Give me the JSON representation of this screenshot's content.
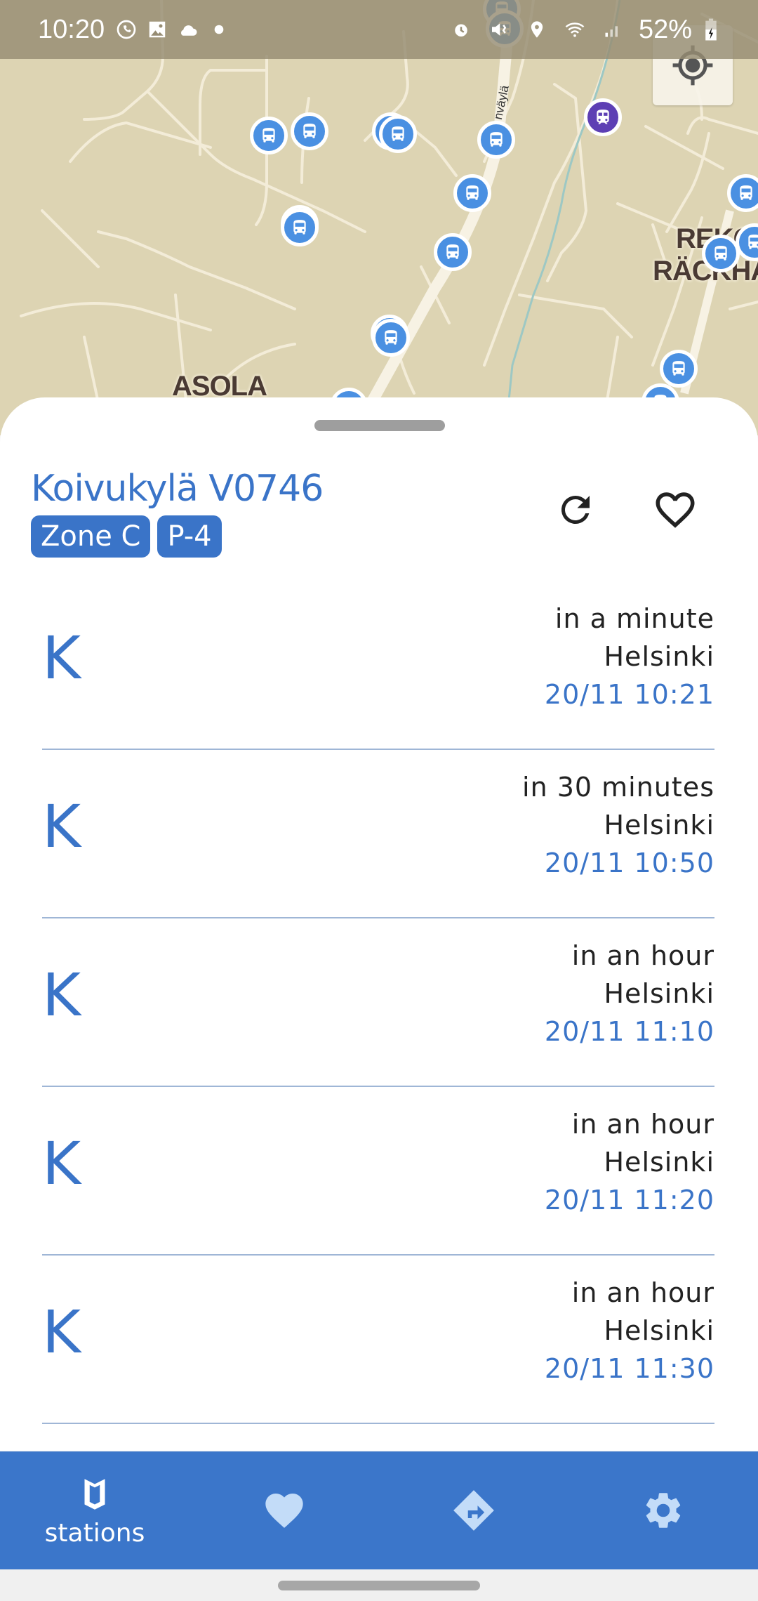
{
  "status_bar": {
    "time": "10:20",
    "left_icons": [
      "whatsapp-icon",
      "image-icon",
      "cloud-icon",
      "dot-icon"
    ],
    "right_icons": [
      "alarm-icon",
      "vibrate-mute-icon",
      "location-icon",
      "wifi-icon",
      "signal-icon"
    ],
    "battery_percent": "52%",
    "battery_charging": true
  },
  "map": {
    "place_labels": [
      "ASOLA",
      "REKO",
      "RÄCKHA"
    ],
    "street_label": "nväylä",
    "locate_button_icon": "my-location-icon",
    "stop_markers": {
      "bus_icon": "bus-icon",
      "train_icon": "train-icon"
    },
    "colors": {
      "land": "#ddd4b3",
      "road": "#f5efdc",
      "bus_stop": "#4a90e2",
      "train_stop": "#5d3fb4",
      "water": "#9dc8c4"
    }
  },
  "stop": {
    "title": "Koivukylä V0746",
    "badges": [
      "Zone C",
      "P-4"
    ],
    "refresh_icon": "refresh-icon",
    "favorite_icon": "heart-outline-icon"
  },
  "departures": [
    {
      "line": "K",
      "when": "in a minute",
      "destination": "Helsinki",
      "time": "20/11 10:21"
    },
    {
      "line": "K",
      "when": "in 30 minutes",
      "destination": "Helsinki",
      "time": "20/11 10:50"
    },
    {
      "line": "K",
      "when": "in an hour",
      "destination": "Helsinki",
      "time": "20/11 11:10"
    },
    {
      "line": "K",
      "when": "in an hour",
      "destination": "Helsinki",
      "time": "20/11 11:20"
    },
    {
      "line": "K",
      "when": "in an hour",
      "destination": "Helsinki",
      "time": "20/11 11:30"
    }
  ],
  "bottom_nav": {
    "items": [
      {
        "label": "stations",
        "icon": "map-icon",
        "active": true
      },
      {
        "label": "",
        "icon": "heart-icon",
        "active": false
      },
      {
        "label": "",
        "icon": "directions-icon",
        "active": false
      },
      {
        "label": "",
        "icon": "settings-icon",
        "active": false
      }
    ]
  },
  "theme": {
    "primary": "#3b76ca",
    "accent_text": "#3a74c8",
    "nav_inactive_icon": "#c3dcf8"
  }
}
